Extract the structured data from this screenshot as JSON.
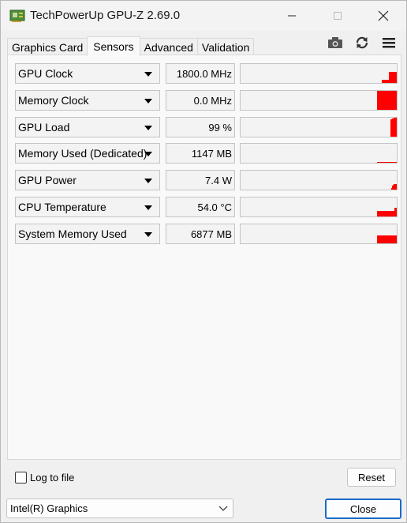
{
  "window": {
    "title": "TechPowerUp GPU-Z 2.69.0"
  },
  "titlebar_icons": {
    "app": "gpu-card-icon",
    "minimize": "minimize-icon",
    "maximize": "maximize-icon",
    "close": "close-icon"
  },
  "tabs": [
    {
      "label": "Graphics Card",
      "active": false
    },
    {
      "label": "Sensors",
      "active": true
    },
    {
      "label": "Advanced",
      "active": false
    },
    {
      "label": "Validation",
      "active": false
    }
  ],
  "toolbar": {
    "camera_icon": "camera-icon",
    "refresh_icon": "refresh-icon",
    "menu_icon": "hamburger-menu-icon"
  },
  "sensors": [
    {
      "name": "GPU Clock",
      "value": "1800.0 MHz",
      "history": [
        0,
        0,
        0,
        0,
        0,
        0,
        0.15,
        0.15,
        0.15,
        0.15,
        0.15,
        0.15,
        0.15,
        0.15,
        0.15,
        0.6,
        0.6,
        0.6,
        0.6,
        0.6,
        0.6,
        0.6,
        0.6,
        0.6,
        0.6
      ]
    },
    {
      "name": "Memory Clock",
      "value": "0.0 MHz",
      "history": [
        1,
        1,
        1,
        1,
        1,
        1,
        1,
        1,
        1,
        1,
        1,
        1,
        1,
        1,
        1,
        1,
        1,
        1,
        1,
        1,
        1,
        1,
        1,
        1,
        1
      ]
    },
    {
      "name": "GPU Load",
      "value": "99 %",
      "history": [
        0,
        0,
        0,
        0,
        0,
        0,
        0,
        0,
        0,
        0,
        0,
        0,
        0,
        0,
        0,
        0,
        0,
        0.9,
        0.9,
        0.95,
        0.95,
        0.99,
        0.99,
        0.99,
        0.99
      ]
    },
    {
      "name": "Memory Used (Dedicated)",
      "value": "1147 MB",
      "history": [
        0.06,
        0.06,
        0.06,
        0.06,
        0.06,
        0.06,
        0.06,
        0.06,
        0.06,
        0.06,
        0.06,
        0.06,
        0.06,
        0.06,
        0.06,
        0.06,
        0.06,
        0.06,
        0.06,
        0.06,
        0.06,
        0.06,
        0.06,
        0.06,
        0.06
      ]
    },
    {
      "name": "GPU Power",
      "value": "7.4 W",
      "history": [
        0,
        0,
        0,
        0,
        0,
        0,
        0,
        0,
        0,
        0,
        0,
        0,
        0,
        0,
        0,
        0,
        0,
        0,
        0.1,
        0.2,
        0.25,
        0.3,
        0.3,
        0.3,
        0.3
      ]
    },
    {
      "name": "CPU Temperature",
      "value": "54.0 °C",
      "history": [
        0.3,
        0.3,
        0.3,
        0.3,
        0.3,
        0.3,
        0.3,
        0.3,
        0.3,
        0.3,
        0.3,
        0.3,
        0.3,
        0.3,
        0.3,
        0.3,
        0.3,
        0.3,
        0.3,
        0.3,
        0.3,
        0.3,
        0.45,
        0.45,
        0.45
      ]
    },
    {
      "name": "System Memory Used",
      "value": "6877 MB",
      "history": [
        0.42,
        0.42,
        0.42,
        0.42,
        0.42,
        0.42,
        0.42,
        0.42,
        0.42,
        0.42,
        0.42,
        0.42,
        0.42,
        0.42,
        0.42,
        0.42,
        0.42,
        0.42,
        0.42,
        0.42,
        0.42,
        0.42,
        0.42,
        0.42,
        0.42
      ]
    }
  ],
  "graph_color": "#ff0000",
  "footer": {
    "log_label": "Log to file",
    "log_checked": false,
    "reset_label": "Reset",
    "gpu_selected": "Intel(R) Graphics",
    "close_label": "Close"
  }
}
